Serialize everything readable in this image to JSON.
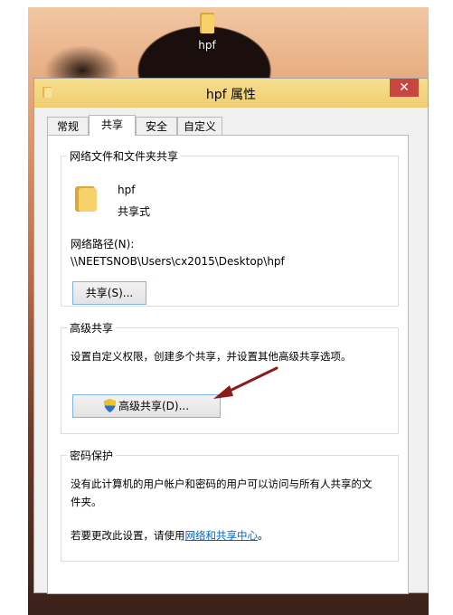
{
  "desktop": {
    "icon_label": "hpf"
  },
  "window": {
    "title": "hpf 属性",
    "close_glyph": "✕",
    "tabs": [
      {
        "label": "常规"
      },
      {
        "label": "共享",
        "active": true
      },
      {
        "label": "安全"
      },
      {
        "label": "自定义"
      }
    ]
  },
  "network_share": {
    "legend": "网络文件和文件夹共享",
    "folder_name": "hpf",
    "share_status": "共享式",
    "path_label": "网络路径(N):",
    "path_value": "\\\\NEETSNOB\\Users\\cx2015\\Desktop\\hpf",
    "share_button": "共享(S)..."
  },
  "advanced_share": {
    "legend": "高级共享",
    "description": "设置自定义权限，创建多个共享，并设置其他高级共享选项。",
    "button": "高级共享(D)..."
  },
  "password_protection": {
    "legend": "密码保护",
    "description_line1": "没有此计算机的用户帐户和密码的用户可以访问与所有人共享的文",
    "description_line2": "件夹。",
    "change_prefix": "若要更改此设置，请使用",
    "change_link": "网络和共享中心",
    "change_suffix": "。"
  },
  "colors": {
    "titlebar": "#f5d98a",
    "close": "#c7463d",
    "arrow": "#8b1a1a",
    "link": "#0066cc"
  }
}
